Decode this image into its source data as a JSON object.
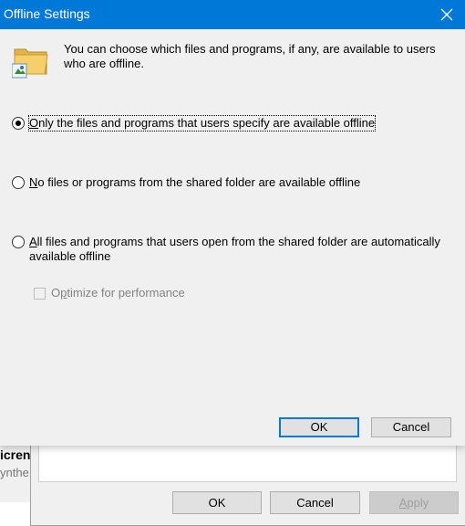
{
  "dialog": {
    "title": "Offline Settings",
    "intro": "You can choose which files and programs, if any, are available to users who are offline.",
    "options": [
      {
        "accel": "O",
        "rest": "nly the files and programs that users specify are available offline",
        "checked": true
      },
      {
        "accel": "N",
        "rest": "o files or programs from the shared folder are available offline",
        "checked": false
      },
      {
        "accel": "A",
        "rest": "ll files and programs that users open from the shared folder are automatically available offline",
        "checked": false
      }
    ],
    "optimize": {
      "pre": "O",
      "accel": "p",
      "rest": "timize for performance",
      "checked": false,
      "enabled": false
    },
    "ok_label": "OK",
    "cancel_label": "Cancel"
  },
  "background": {
    "text1": "icren",
    "text2": "ynthe",
    "ok_label": "OK",
    "cancel_label": "Cancel",
    "apply_label": "Apply"
  },
  "colors": {
    "titlebar": "#0078d7",
    "dialog_bg": "#f0f0f0",
    "default_border": "#0078d7"
  }
}
